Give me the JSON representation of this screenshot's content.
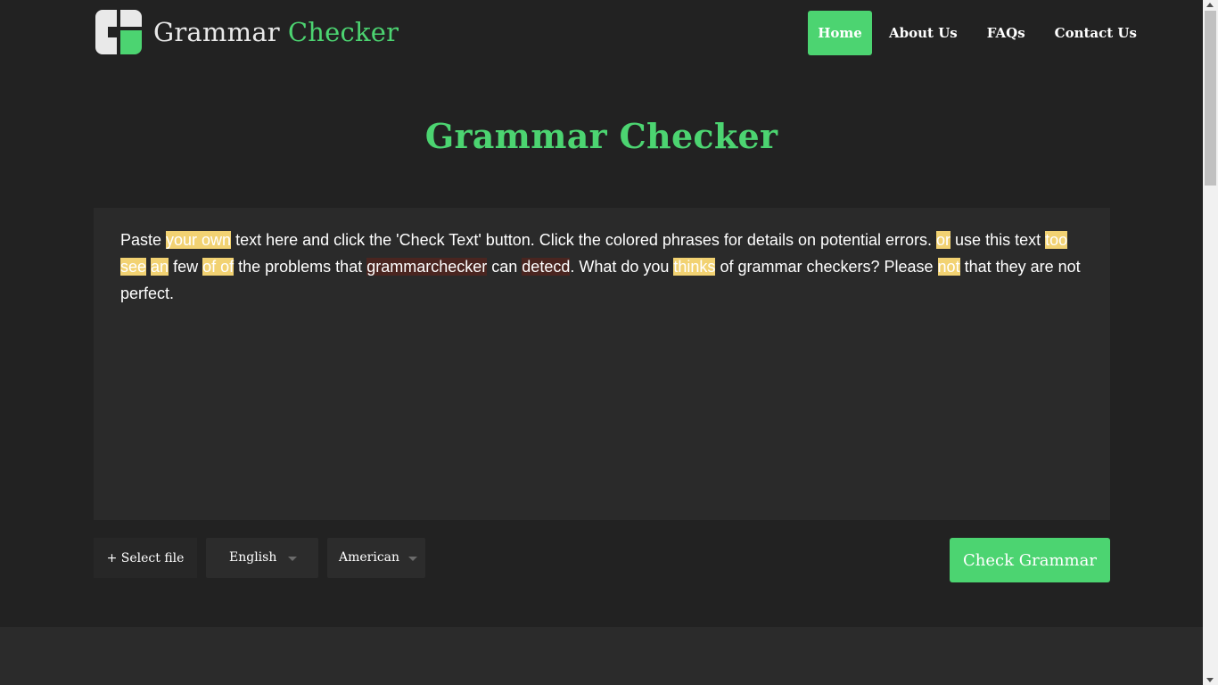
{
  "header": {
    "brand_part1": "Grammar",
    "brand_part2": "Checker",
    "logo_icon": "g-logo-icon",
    "nav": {
      "home": "Home",
      "about": "About Us",
      "faqs": "FAQs",
      "contact": "Contact Us"
    }
  },
  "main": {
    "title": "Grammar Checker",
    "editor": {
      "t1": "Paste ",
      "e1": "your own",
      "t2": " text here and click the 'Check Text' button. Click the colored phrases for details on potential errors. ",
      "e2": "or",
      "t3": " use this text ",
      "e3": "too",
      "t4": " ",
      "e4": "see",
      "t5": " ",
      "e5": "an",
      "t6": " few ",
      "e6": "of of",
      "t7": " the problems that ",
      "e7": "grammarchecker",
      "t8": " can ",
      "e8": "detecd",
      "t9": ". What do you ",
      "e9": "thinks",
      "t10": " of grammar checkers? Please ",
      "e10": "not",
      "t11": " that they are not perfect."
    },
    "file_button": "+ Select file",
    "language": "English",
    "dialect": "American",
    "check_button": "Check Grammar"
  },
  "colors": {
    "accent": "#4cd471",
    "background": "#222222",
    "editor_bg": "#2a2a2a",
    "grammar_highlight": "#f2d272",
    "spelling_highlight": "#4a2520"
  }
}
